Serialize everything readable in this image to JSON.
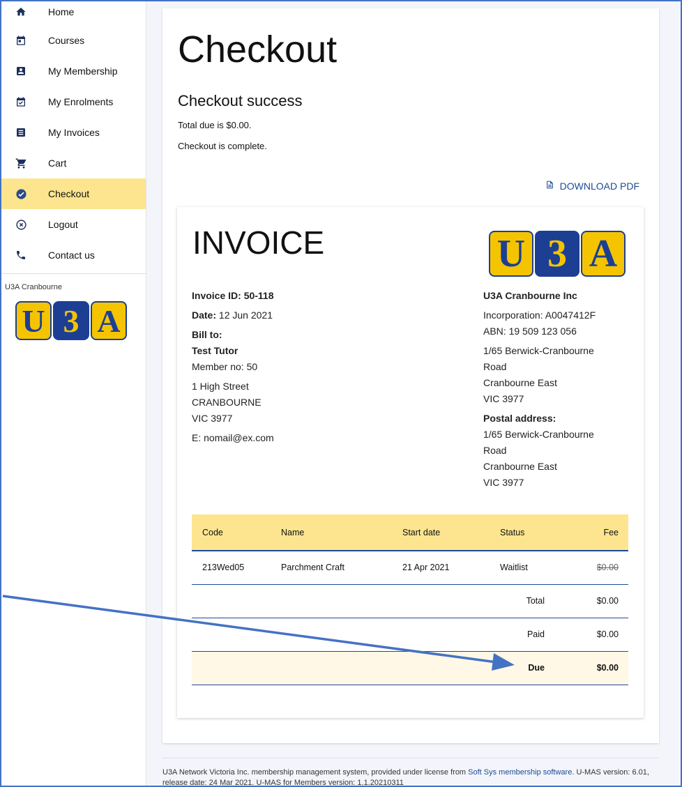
{
  "sidebar": {
    "items": [
      {
        "label": "Home",
        "icon": "home-icon"
      },
      {
        "label": "Courses",
        "icon": "calendar-icon"
      },
      {
        "label": "My Membership",
        "icon": "badge-icon"
      },
      {
        "label": "My Enrolments",
        "icon": "calendar-check-icon"
      },
      {
        "label": "My Invoices",
        "icon": "list-icon"
      },
      {
        "label": "Cart",
        "icon": "cart-icon"
      },
      {
        "label": "Checkout",
        "icon": "check-circle-icon",
        "active": true
      },
      {
        "label": "Logout",
        "icon": "close-circle-icon"
      },
      {
        "label": "Contact us",
        "icon": "phone-icon"
      }
    ],
    "org_name": "U3A Cranbourne"
  },
  "logo": {
    "letters": [
      "U",
      "3",
      "A"
    ]
  },
  "main": {
    "title": "Checkout",
    "subtitle": "Checkout success",
    "total_msg": "Total due is $0.00.",
    "complete_msg": "Checkout is complete.",
    "download_label": "DOWNLOAD PDF"
  },
  "invoice": {
    "title": "INVOICE",
    "id_label": "Invoice ID:",
    "id_value": "50-118",
    "date_label": "Date:",
    "date_value": "12 Jun 2021",
    "bill_to_label": "Bill to:",
    "bill_name": "Test Tutor",
    "member_no": "Member no: 50",
    "address_lines": [
      "1 High Street",
      "CRANBOURNE",
      "VIC 3977"
    ],
    "email": "E: nomail@ex.com",
    "org_name": "U3A Cranbourne Inc",
    "incorporation": "Incorporation: A0047412F",
    "abn": "ABN: 19 509 123 056",
    "org_address": [
      "1/65 Berwick-Cranbourne",
      "Road",
      "Cranbourne East",
      "VIC 3977"
    ],
    "postal_label": "Postal address:",
    "postal_address": [
      "1/65 Berwick-Cranbourne",
      "Road",
      "Cranbourne East",
      "VIC 3977"
    ]
  },
  "table": {
    "headers": [
      "Code",
      "Name",
      "Start date",
      "Status",
      "Fee"
    ],
    "rows": [
      {
        "code": "213Wed05",
        "name": "Parchment Craft",
        "start": "21 Apr 2021",
        "status": "Waitlist",
        "fee": "$0.00"
      }
    ],
    "total_label": "Total",
    "total_value": "$0.00",
    "paid_label": "Paid",
    "paid_value": "$0.00",
    "due_label": "Due",
    "due_value": "$0.00"
  },
  "footer": {
    "text1": "U3A Network Victoria Inc. membership management system, provided under license from ",
    "link": "Soft Sys membership software",
    "text2": ". U-MAS version: 6.01, release date: 24 Mar 2021. U-MAS for Members version: 1.1.20210311"
  },
  "colors": {
    "accent_yellow": "#fde58f",
    "brand_blue": "#1c3f94",
    "annotation_arrow": "#4472c4"
  }
}
